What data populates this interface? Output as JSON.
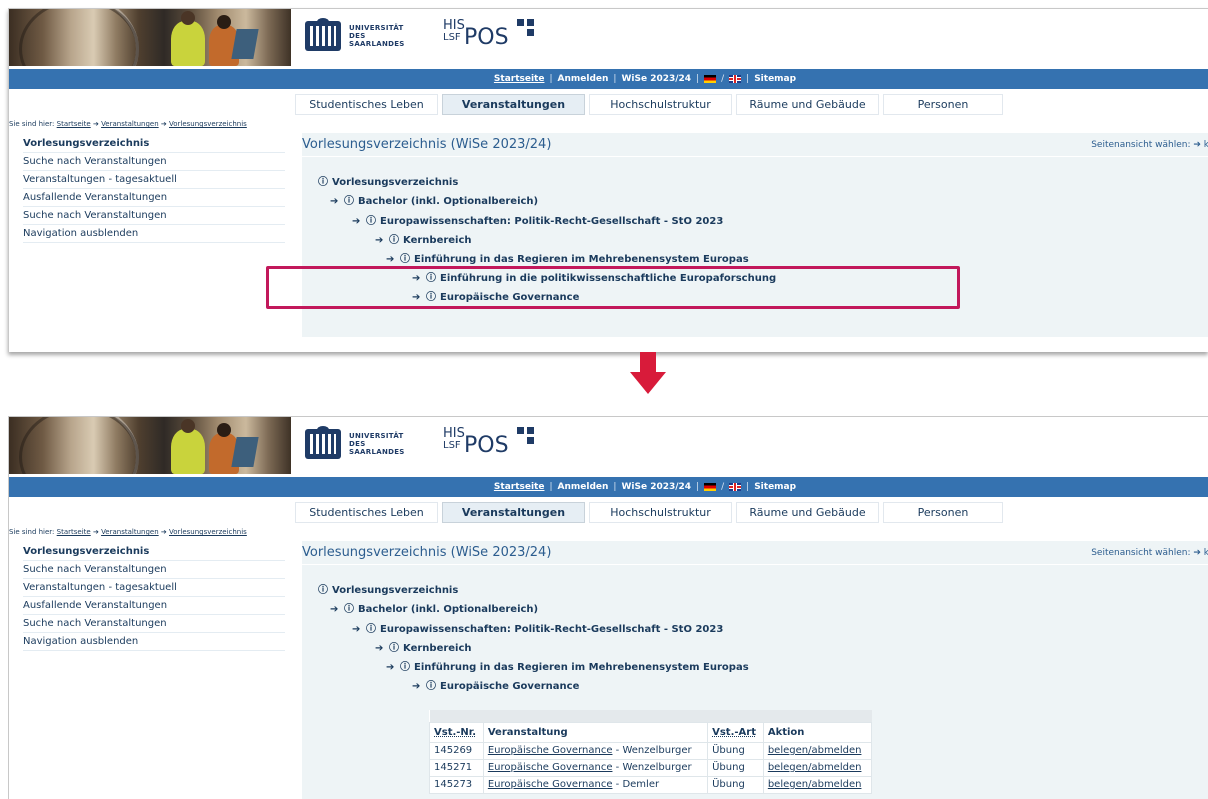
{
  "header": {
    "university_lines": [
      "UNIVERSITÄT",
      "DES",
      "SAARLANDES"
    ],
    "his": "HIS",
    "lsf": "LSF",
    "pos": "POS"
  },
  "topbar": {
    "home": "Startseite",
    "login": "Anmelden",
    "semester": "WiSe 2023/24",
    "slash": "/",
    "sitemap": "Sitemap",
    "separator": "|"
  },
  "tabs": [
    "Studentisches Leben",
    "Veranstaltungen",
    "Hochschulstruktur",
    "Räume und Gebäude",
    "Personen"
  ],
  "breadcrumb": {
    "prefix": "Sie sind hier:",
    "items": [
      "Startseite",
      "Veranstaltungen",
      "Vorlesungsverzeichnis"
    ]
  },
  "sidebar": {
    "items": [
      "Vorlesungsverzeichnis",
      "Suche nach Veranstaltungen",
      "Veranstaltungen - tagesaktuell",
      "Ausfallende Veranstaltungen",
      "Suche nach Veranstaltungen",
      "Navigation ausblenden"
    ]
  },
  "content": {
    "title": "Vorlesungsverzeichnis (WiSe 2023/24)",
    "view_label": "Seitenansicht wählen:",
    "view_suffix": "k"
  },
  "tree": {
    "nodes": [
      "Vorlesungsverzeichnis",
      "Bachelor (inkl. Optionalbereich)",
      "Europawissenschaften: Politik-Recht-Gesellschaft - StO 2023",
      "Kernbereich",
      "Einführung in das Regieren im Mehrebenensystem Europas",
      "Einführung in die politikwissenschaftliche Europaforschung",
      "Europäische Governance"
    ]
  },
  "courses": {
    "headers": {
      "nr": "Vst.-Nr.",
      "name": "Veranstaltung",
      "type": "Vst.-Art",
      "action": "Aktion"
    },
    "dash": "-",
    "rows": [
      {
        "nr": "145269",
        "name": "Europäische Governance",
        "lecturer": "Wenzelburger",
        "type": "Übung",
        "action": "belegen/abmelden"
      },
      {
        "nr": "145271",
        "name": "Europäische Governance",
        "lecturer": "Wenzelburger",
        "type": "Übung",
        "action": "belegen/abmelden"
      },
      {
        "nr": "145273",
        "name": "Europäische Governance",
        "lecturer": "Demler",
        "type": "Übung",
        "action": "belegen/abmelden"
      }
    ]
  },
  "colors": {
    "accent": "#3572b0",
    "highlight": "#c2185b",
    "arrow": "#d81b3a"
  }
}
